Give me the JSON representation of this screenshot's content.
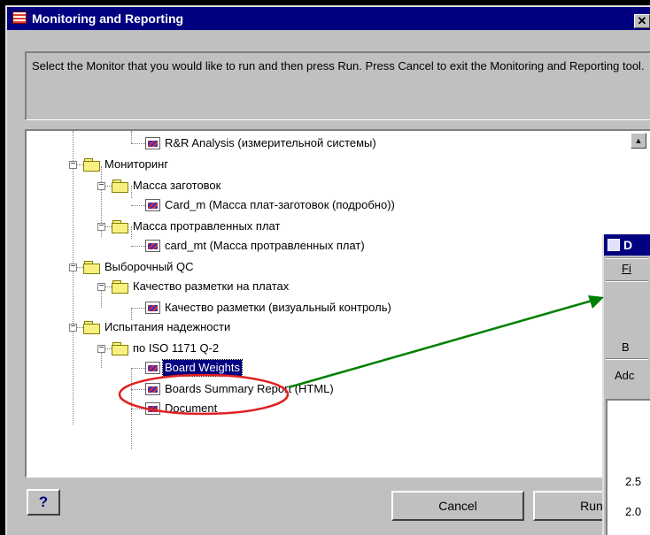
{
  "window": {
    "title": "Monitoring and Reporting",
    "close_glyph": "✕"
  },
  "instructions": "Select the Monitor that you would like to run and then press Run.  Press Cancel to exit the Monitoring and Reporting tool.",
  "tree": {
    "items": [
      {
        "label": "R&R Analysis (измерительной системы)",
        "type": "monitor",
        "level": 3
      },
      {
        "label": "Мониторинг",
        "type": "folder",
        "level": 1
      },
      {
        "label": "Масса заготовок",
        "type": "folder",
        "level": 2
      },
      {
        "label": "Card_m (Масса плат-заготовок (подробно))",
        "type": "monitor",
        "level": 3
      },
      {
        "label": "Масса протравленных плат",
        "type": "folder",
        "level": 2
      },
      {
        "label": "card_mt (Масса протравленных плат)",
        "type": "monitor",
        "level": 3
      },
      {
        "label": "Выборочный QC",
        "type": "folder",
        "level": 1
      },
      {
        "label": "Качество разметки на платах",
        "type": "folder",
        "level": 2
      },
      {
        "label": "Качество разметки (визуальный контроль)",
        "type": "monitor",
        "level": 3
      },
      {
        "label": "Испытания надежности",
        "type": "folder",
        "level": 1
      },
      {
        "label": "по ISO 1171 Q-2",
        "type": "folder",
        "level": 2
      },
      {
        "label": "Board Weights",
        "type": "monitor",
        "level": 3,
        "selected": true
      },
      {
        "label": "Boards Summary Report (HTML)",
        "type": "monitor",
        "level": 3
      },
      {
        "label": "Document",
        "type": "monitor",
        "level": 3
      }
    ],
    "scroll_up_glyph": "▲"
  },
  "buttons": {
    "help": "?",
    "cancel": "Cancel",
    "run": "Run"
  },
  "background_window": {
    "title": "D",
    "menu_file": "Fi",
    "item_b": "B",
    "item_add": "Adc",
    "value_1": "2.5",
    "value_2": "2.0"
  },
  "annotation": {
    "circle_color": "#e02020",
    "arrow_color": "#008000"
  }
}
